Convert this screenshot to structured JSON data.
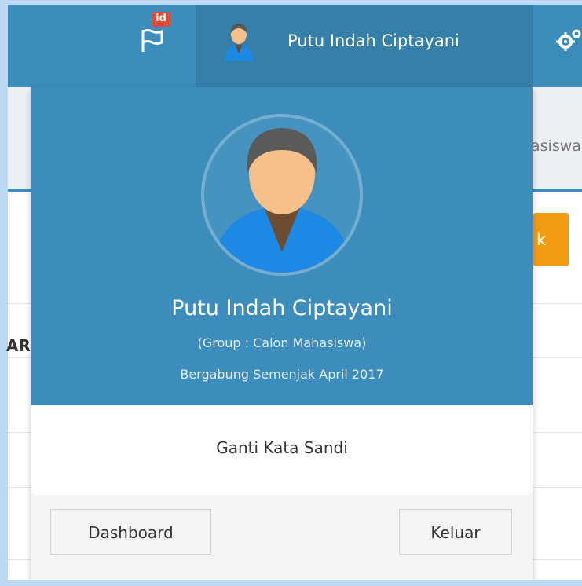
{
  "navbar": {
    "flag_badge": "id",
    "user_name": "Putu Indah Ciptayani"
  },
  "background": {
    "breadcrumb_fragment": "asiswa",
    "orange_button_fragment": "k",
    "column_header_fragment": "AR"
  },
  "user_dropdown": {
    "name": "Putu Indah Ciptayani",
    "group": "(Group : Calon Mahasiswa)",
    "member_since": "Bergabung Semenjak April 2017",
    "change_password": "Ganti Kata Sandi",
    "dashboard_button": "Dashboard",
    "logout_button": "Keluar"
  },
  "colors": {
    "navbar": "#3c8dbc",
    "navbar_active": "#367fa9",
    "badge": "#dd4b39",
    "accent_orange": "#f39c12"
  }
}
